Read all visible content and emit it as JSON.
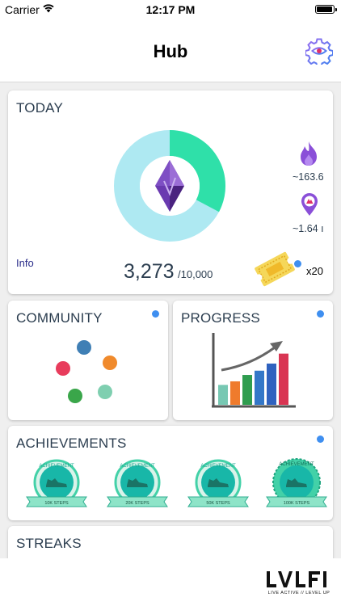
{
  "status_bar": {
    "carrier": "Carrier",
    "time": "12:17 PM"
  },
  "header": {
    "title": "Hub",
    "settings_icon": "gear-eye-icon"
  },
  "today": {
    "title": "TODAY",
    "calories": "~163.6",
    "distance": "~1.64 ı",
    "info_label": "Info",
    "steps": "3,273",
    "steps_goal": "/10,000",
    "ticket_count": "x20",
    "progress_fraction": 0.3273,
    "ring_colors": [
      "#2fe0a9",
      "#a8e6f2"
    ],
    "calories_icon": "flame-icon",
    "distance_icon": "map-pin-icon",
    "center_icon": "purple-crystal-icon",
    "ticket_icon": "golden-ticket-icon",
    "has_notification": true
  },
  "community": {
    "title": "COMMUNITY",
    "has_notification": true,
    "dot_colors": [
      "#3f7fb5",
      "#e83c5c",
      "#f08a2c",
      "#3aa64a",
      "#7fcfb0"
    ]
  },
  "progress": {
    "title": "PROGRESS",
    "has_notification": true,
    "bar_levels": [
      0.28,
      0.33,
      0.42,
      0.48,
      0.58,
      0.72
    ],
    "bar_colors": [
      "#77c8b3",
      "#ef7b2c",
      "#2f9d4f",
      "#3377c8",
      "#2f62bf",
      "#d93553"
    ]
  },
  "achievements": {
    "title": "ACHIEVEMENTS",
    "has_notification": true,
    "badges": [
      {
        "ribbon": "10K STEPS",
        "arc": "ACHIEVEMENT"
      },
      {
        "ribbon": "20K STEPS",
        "arc": "ACHIEVEMENT"
      },
      {
        "ribbon": "50K STEPS",
        "arc": "ACHIEVEMENT"
      },
      {
        "ribbon": "100K STEPS",
        "arc": "ACHIEVEMENT"
      }
    ]
  },
  "streaks": {
    "title": "STREAKS"
  },
  "footer": {
    "tagline": "LIVE ACTIVE // LEVEL UP"
  }
}
